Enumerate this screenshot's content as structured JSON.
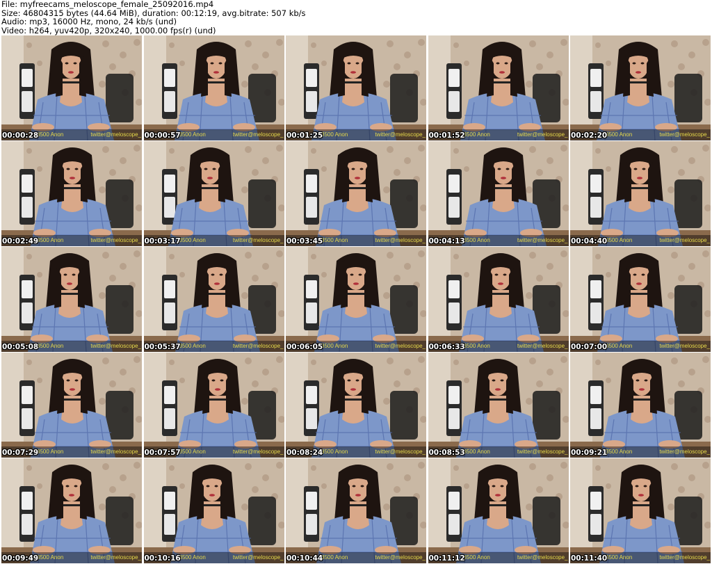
{
  "header": {
    "file_line": "File: myfreecams_meloscope_female_25092016.mp4",
    "size_line": "Size: 46804315 bytes (44.64 MiB), duration: 00:12:19, avg.bitrate: 507 kb/s",
    "audio_line": "Audio: mp3, 16000 Hz, mono, 24 kb/s (und)",
    "video_line": "Video: h264, yuv420p, 320x240, 1000.00 fps(r) (und)"
  },
  "overlay": {
    "viewer_text": "3500 Anon",
    "watermark_text": "twitter@meloscope_"
  },
  "colors": {
    "overlay_text": "#e6d94a",
    "wall": "#c9b8a4",
    "shirt": "#7d97c9",
    "hair": "#1e1410",
    "skin": "#d9a889"
  },
  "thumbnails": [
    {
      "timestamp": "00:00:28"
    },
    {
      "timestamp": "00:00:57"
    },
    {
      "timestamp": "00:01:25"
    },
    {
      "timestamp": "00:01:52"
    },
    {
      "timestamp": "00:02:20"
    },
    {
      "timestamp": "00:02:49"
    },
    {
      "timestamp": "00:03:17"
    },
    {
      "timestamp": "00:03:45"
    },
    {
      "timestamp": "00:04:13"
    },
    {
      "timestamp": "00:04:40"
    },
    {
      "timestamp": "00:05:08"
    },
    {
      "timestamp": "00:05:37"
    },
    {
      "timestamp": "00:06:05"
    },
    {
      "timestamp": "00:06:33"
    },
    {
      "timestamp": "00:07:00"
    },
    {
      "timestamp": "00:07:29"
    },
    {
      "timestamp": "00:07:57"
    },
    {
      "timestamp": "00:08:24"
    },
    {
      "timestamp": "00:08:53"
    },
    {
      "timestamp": "00:09:21"
    },
    {
      "timestamp": "00:09:49"
    },
    {
      "timestamp": "00:10:16"
    },
    {
      "timestamp": "00:10:44"
    },
    {
      "timestamp": "00:11:12"
    },
    {
      "timestamp": "00:11:40"
    }
  ]
}
